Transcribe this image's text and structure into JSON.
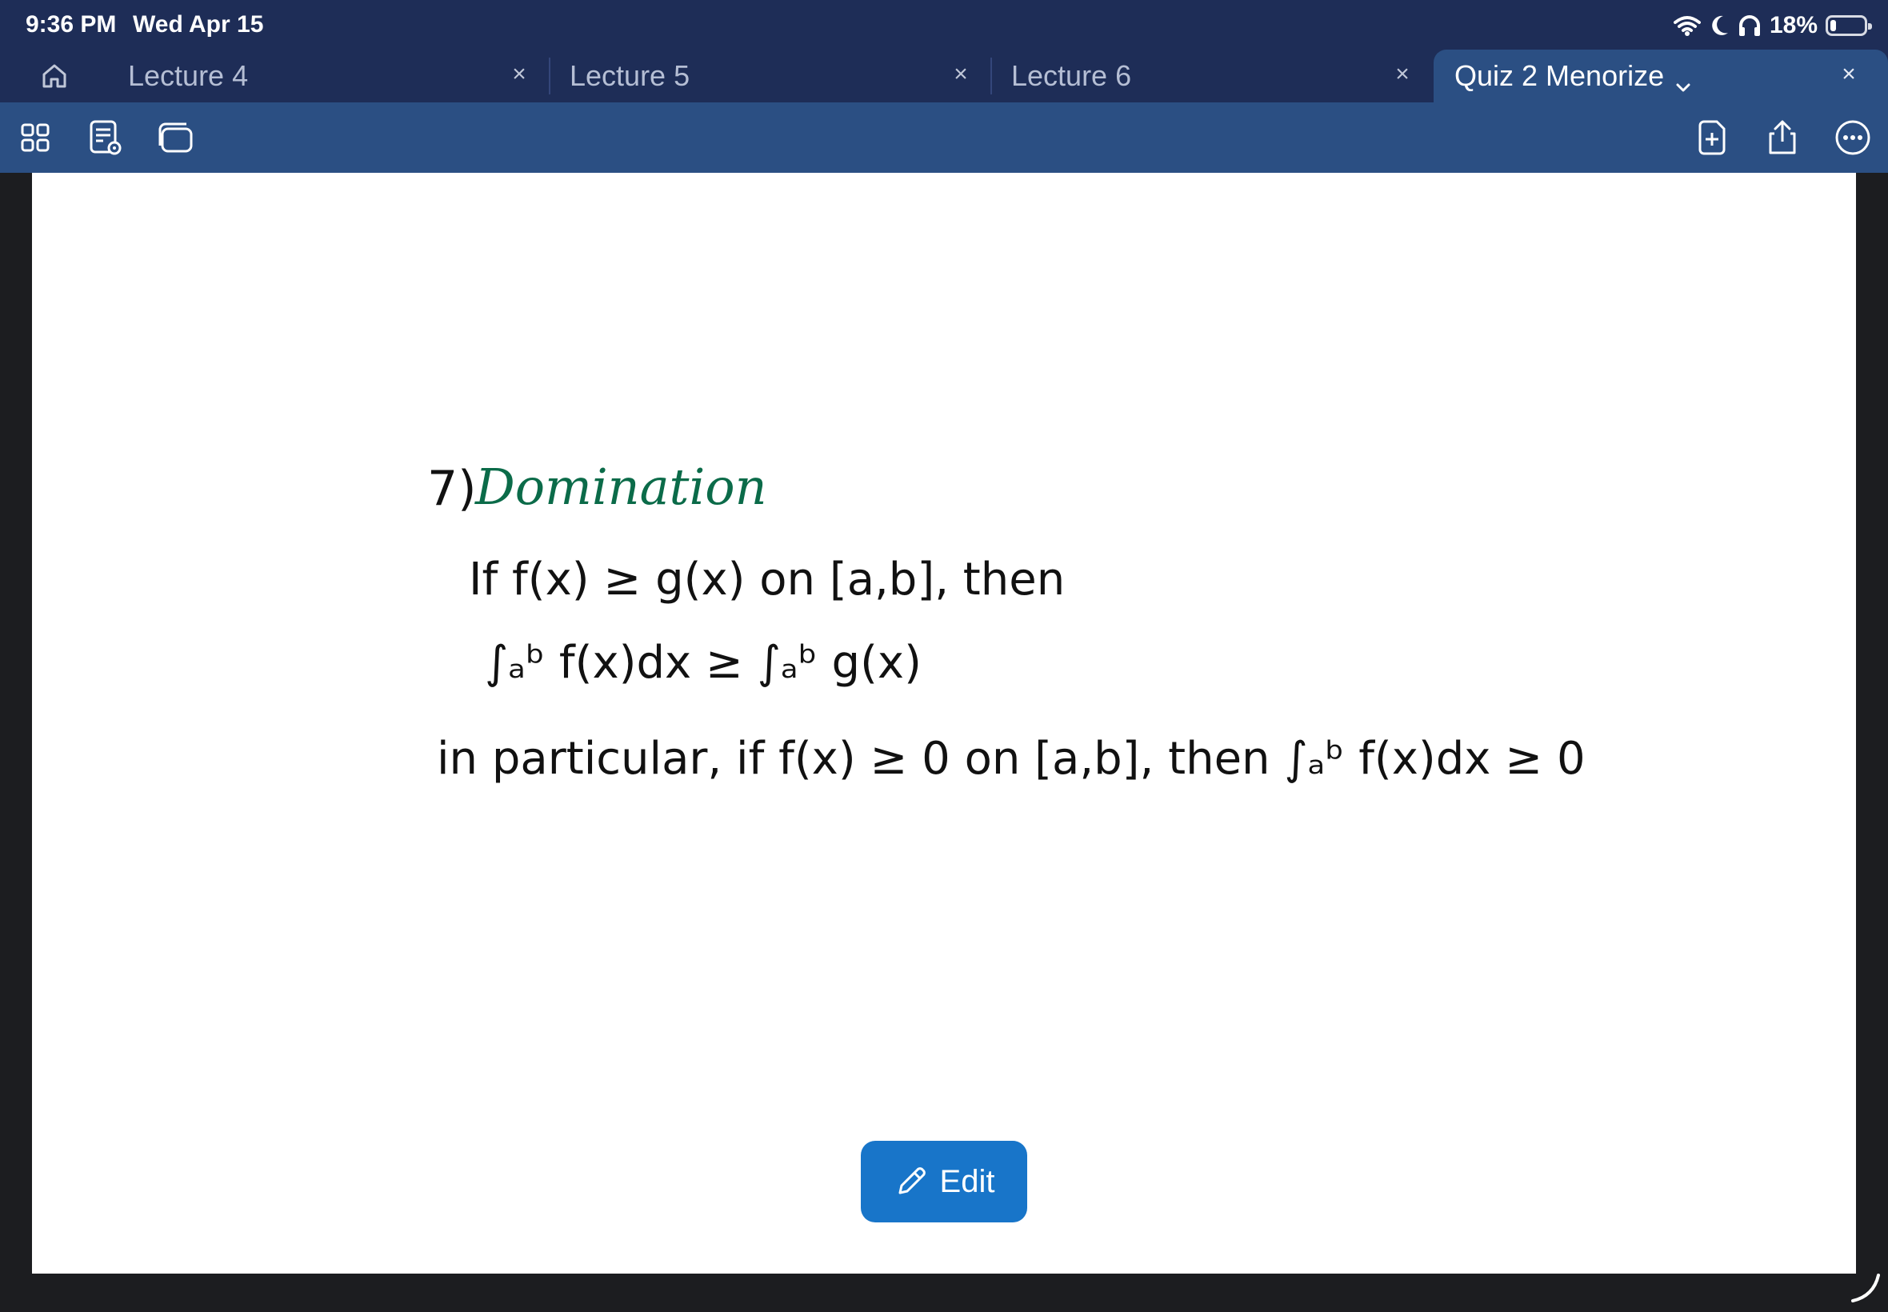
{
  "status_bar": {
    "time": "9:36 PM",
    "date": "Wed Apr 15",
    "battery_percent": "18%",
    "battery_level": 0.18,
    "icons": [
      "wifi-icon",
      "moon-icon",
      "headphones-icon",
      "battery-icon"
    ]
  },
  "tabs": [
    {
      "label": "Lecture 4",
      "close": "×"
    },
    {
      "label": "Lecture 5",
      "close": "×"
    },
    {
      "label": "Lecture 6",
      "close": "×"
    }
  ],
  "active_tab": {
    "label": "Quiz 2 Menorize",
    "close": "×"
  },
  "toolbar": {
    "left_icons": [
      "grid-icon",
      "notes-view-icon",
      "windows-icon"
    ],
    "right_icons": [
      "add-page-icon",
      "share-icon",
      "more-icon"
    ]
  },
  "note": {
    "number": "7)",
    "title": "Domination",
    "line1": "If f(x) ≥ g(x) on [a,b], then",
    "line2": "∫ₐᵇ f(x)dx ≥ ∫ₐᵇ g(x)",
    "line3": "in particular, if f(x) ≥ 0 on [a,b], then ∫ₐᵇ f(x)dx ≥ 0",
    "title_color": "#0b6b49"
  },
  "edit_button": {
    "label": "Edit",
    "icon": "pencil-icon"
  },
  "colors": {
    "tab_bar": "#1e2d57",
    "toolbar": "#2b4f83",
    "edit_button": "#1875c9"
  }
}
